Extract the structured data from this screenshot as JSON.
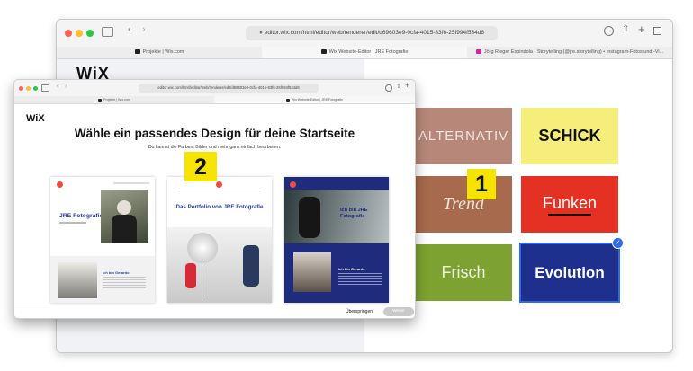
{
  "back_window": {
    "url": "editor.wix.com/html/editor/web/renderer/edit/d69603e9-0cfa-4015-83f6-25f994f534d6",
    "tabs": [
      {
        "label": "Projekte | Wix.com"
      },
      {
        "label": "Wix Website-Editor | JRE Fotografie"
      },
      {
        "label": "Jörg Rieger Espindola - Storytelling (@jre.storytelling) • Instagram-Fotos und -Vi..."
      }
    ],
    "logo": "WiX",
    "font_tiles": [
      {
        "label": "ALTERNATIV",
        "bg": "#b7887a",
        "color": "#efe7e3"
      },
      {
        "label": "SCHICK",
        "bg": "#f6ee7a",
        "color": "#111111"
      },
      {
        "label": "Trend",
        "bg": "#a76a4c",
        "color": "#f3e3d7"
      },
      {
        "label": "Funken",
        "bg": "#e53124",
        "color": "#ffffff"
      },
      {
        "label": "Frisch",
        "bg": "#7ea231",
        "color": "#eef3e0"
      },
      {
        "label": "Evolution",
        "bg": "#1e2f8c",
        "color": "#ffffff",
        "selected": true
      }
    ],
    "badge": "1"
  },
  "front_window": {
    "url": "editor.wix.com/html/editor/web/renderer/edit/d69603e9-0cfa-4015-83f6-25f994f534d6",
    "tabs": [
      {
        "label": "Projekte | Wix.com"
      },
      {
        "label": "Wix Website-Editor | JRE Fotografie"
      }
    ],
    "logo": "WiX",
    "title": "Wähle ein passendes Design für deine Startseite",
    "subtitle": "Du kannst die Farben, Bilder und mehr ganz einfach bearbeiten.",
    "badge": "2",
    "designs": [
      {
        "heading": "JRE Fotografie",
        "section": "Ich bin Gerardo"
      },
      {
        "heading": "Das Portfolio von JRE Fotografie"
      },
      {
        "heading": "Ich bin JRE Fotografie",
        "section": "Ich bin Gerardo"
      }
    ],
    "skip_label": "Überspringen",
    "next_label": "Weiter"
  },
  "colors": {
    "accent_blue": "#2e6be6",
    "badge_yellow": "#f7e300",
    "wix_red": "#ef4b3f"
  }
}
